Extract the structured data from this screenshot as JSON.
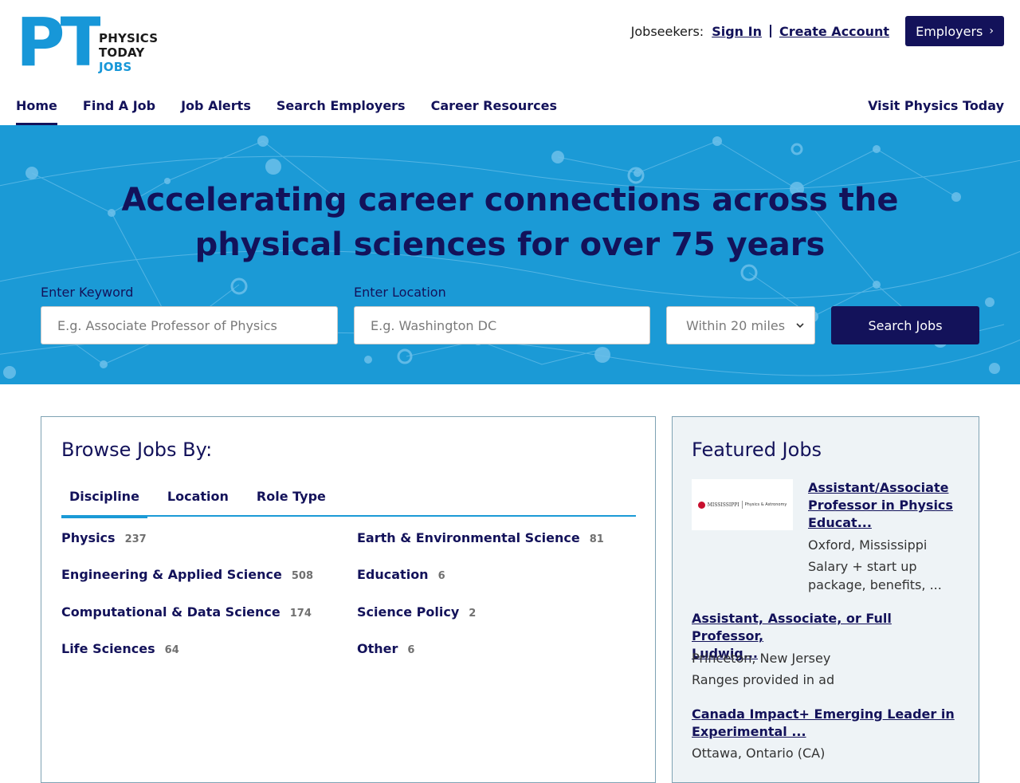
{
  "logo": {
    "mark": "PT",
    "line1": "PHYSICS",
    "line2a": "TODAY ",
    "line2b": "JOBS"
  },
  "account": {
    "jobseekers_label": "Jobseekers:",
    "sign_in": "Sign In",
    "create_account": "Create Account",
    "employers": "Employers"
  },
  "nav": {
    "items": [
      "Home",
      "Find A Job",
      "Job Alerts",
      "Search Employers",
      "Career Resources"
    ],
    "right": "Visit Physics Today"
  },
  "hero": {
    "title": "Accelerating career connections across the physical sciences for over 75 years",
    "keyword_label": "Enter Keyword",
    "keyword_placeholder": "E.g. Associate Professor of Physics",
    "location_label": "Enter Location",
    "location_placeholder": "E.g. Washington DC",
    "radius_selected": "Within 20 miles",
    "search_button": "Search Jobs"
  },
  "browse": {
    "title": "Browse Jobs By:",
    "tabs": [
      "Discipline",
      "Location",
      "Role Type"
    ],
    "disciplines": [
      {
        "name": "Physics",
        "count": "237"
      },
      {
        "name": "Earth & Environmental Science",
        "count": "81"
      },
      {
        "name": "Engineering & Applied Science",
        "count": "508"
      },
      {
        "name": "Education",
        "count": "6"
      },
      {
        "name": "Computational & Data Science",
        "count": "174"
      },
      {
        "name": "Science Policy",
        "count": "2"
      },
      {
        "name": "Life Sciences",
        "count": "64"
      },
      {
        "name": "Other",
        "count": "6"
      }
    ]
  },
  "featured": {
    "title": "Featured Jobs",
    "logo_text": {
      "uni": "MISSISSIPPI",
      "dept": "Physics & Astronomy"
    },
    "jobs": [
      {
        "title_l1": "Assistant/Associate",
        "title_l2": "Professor in Physics",
        "title_l3": "Educat...",
        "location": "Oxford, Mississippi",
        "salary_l1": "Salary + start up",
        "salary_l2": "package, benefits, ..."
      },
      {
        "title_l1": "Assistant, Associate, or Full Professor,",
        "title_l2": "Ludwig...",
        "location": "Princeton, New Jersey",
        "salary": "Ranges provided in ad"
      },
      {
        "title_l1": "Canada Impact+ Emerging Leader in",
        "title_l2": "Experimental ...",
        "location": "Ottawa, Ontario (CA)"
      }
    ]
  },
  "colors": {
    "brand_blue": "#1b9ad6",
    "navy": "#13125a"
  }
}
